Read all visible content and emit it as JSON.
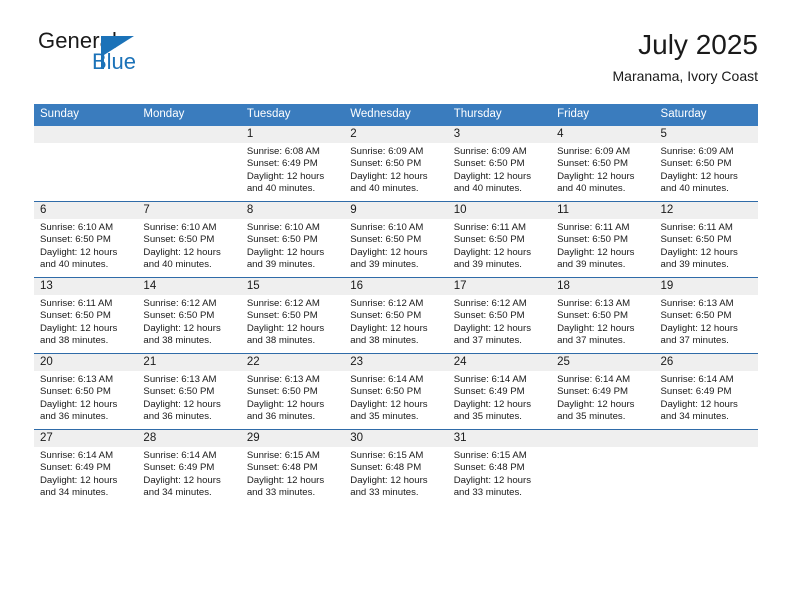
{
  "logo": {
    "word1": "General",
    "word2": "Blue",
    "icon": "triangle-flag-icon",
    "brand_color": "#1b72b8"
  },
  "header": {
    "title": "July 2025",
    "subtitle": "Maranama, Ivory Coast"
  },
  "theme": {
    "header_bg": "#3a7cbe",
    "row_divider": "#2f6ba8",
    "daynum_band": "#efefef"
  },
  "weekday_headers": [
    "Sunday",
    "Monday",
    "Tuesday",
    "Wednesday",
    "Thursday",
    "Friday",
    "Saturday"
  ],
  "weeks": [
    [
      {
        "day": "",
        "lines": []
      },
      {
        "day": "",
        "lines": []
      },
      {
        "day": "1",
        "lines": [
          "Sunrise: 6:08 AM",
          "Sunset: 6:49 PM",
          "Daylight: 12 hours",
          "and 40 minutes."
        ]
      },
      {
        "day": "2",
        "lines": [
          "Sunrise: 6:09 AM",
          "Sunset: 6:50 PM",
          "Daylight: 12 hours",
          "and 40 minutes."
        ]
      },
      {
        "day": "3",
        "lines": [
          "Sunrise: 6:09 AM",
          "Sunset: 6:50 PM",
          "Daylight: 12 hours",
          "and 40 minutes."
        ]
      },
      {
        "day": "4",
        "lines": [
          "Sunrise: 6:09 AM",
          "Sunset: 6:50 PM",
          "Daylight: 12 hours",
          "and 40 minutes."
        ]
      },
      {
        "day": "5",
        "lines": [
          "Sunrise: 6:09 AM",
          "Sunset: 6:50 PM",
          "Daylight: 12 hours",
          "and 40 minutes."
        ]
      }
    ],
    [
      {
        "day": "6",
        "lines": [
          "Sunrise: 6:10 AM",
          "Sunset: 6:50 PM",
          "Daylight: 12 hours",
          "and 40 minutes."
        ]
      },
      {
        "day": "7",
        "lines": [
          "Sunrise: 6:10 AM",
          "Sunset: 6:50 PM",
          "Daylight: 12 hours",
          "and 40 minutes."
        ]
      },
      {
        "day": "8",
        "lines": [
          "Sunrise: 6:10 AM",
          "Sunset: 6:50 PM",
          "Daylight: 12 hours",
          "and 39 minutes."
        ]
      },
      {
        "day": "9",
        "lines": [
          "Sunrise: 6:10 AM",
          "Sunset: 6:50 PM",
          "Daylight: 12 hours",
          "and 39 minutes."
        ]
      },
      {
        "day": "10",
        "lines": [
          "Sunrise: 6:11 AM",
          "Sunset: 6:50 PM",
          "Daylight: 12 hours",
          "and 39 minutes."
        ]
      },
      {
        "day": "11",
        "lines": [
          "Sunrise: 6:11 AM",
          "Sunset: 6:50 PM",
          "Daylight: 12 hours",
          "and 39 minutes."
        ]
      },
      {
        "day": "12",
        "lines": [
          "Sunrise: 6:11 AM",
          "Sunset: 6:50 PM",
          "Daylight: 12 hours",
          "and 39 minutes."
        ]
      }
    ],
    [
      {
        "day": "13",
        "lines": [
          "Sunrise: 6:11 AM",
          "Sunset: 6:50 PM",
          "Daylight: 12 hours",
          "and 38 minutes."
        ]
      },
      {
        "day": "14",
        "lines": [
          "Sunrise: 6:12 AM",
          "Sunset: 6:50 PM",
          "Daylight: 12 hours",
          "and 38 minutes."
        ]
      },
      {
        "day": "15",
        "lines": [
          "Sunrise: 6:12 AM",
          "Sunset: 6:50 PM",
          "Daylight: 12 hours",
          "and 38 minutes."
        ]
      },
      {
        "day": "16",
        "lines": [
          "Sunrise: 6:12 AM",
          "Sunset: 6:50 PM",
          "Daylight: 12 hours",
          "and 38 minutes."
        ]
      },
      {
        "day": "17",
        "lines": [
          "Sunrise: 6:12 AM",
          "Sunset: 6:50 PM",
          "Daylight: 12 hours",
          "and 37 minutes."
        ]
      },
      {
        "day": "18",
        "lines": [
          "Sunrise: 6:13 AM",
          "Sunset: 6:50 PM",
          "Daylight: 12 hours",
          "and 37 minutes."
        ]
      },
      {
        "day": "19",
        "lines": [
          "Sunrise: 6:13 AM",
          "Sunset: 6:50 PM",
          "Daylight: 12 hours",
          "and 37 minutes."
        ]
      }
    ],
    [
      {
        "day": "20",
        "lines": [
          "Sunrise: 6:13 AM",
          "Sunset: 6:50 PM",
          "Daylight: 12 hours",
          "and 36 minutes."
        ]
      },
      {
        "day": "21",
        "lines": [
          "Sunrise: 6:13 AM",
          "Sunset: 6:50 PM",
          "Daylight: 12 hours",
          "and 36 minutes."
        ]
      },
      {
        "day": "22",
        "lines": [
          "Sunrise: 6:13 AM",
          "Sunset: 6:50 PM",
          "Daylight: 12 hours",
          "and 36 minutes."
        ]
      },
      {
        "day": "23",
        "lines": [
          "Sunrise: 6:14 AM",
          "Sunset: 6:50 PM",
          "Daylight: 12 hours",
          "and 35 minutes."
        ]
      },
      {
        "day": "24",
        "lines": [
          "Sunrise: 6:14 AM",
          "Sunset: 6:49 PM",
          "Daylight: 12 hours",
          "and 35 minutes."
        ]
      },
      {
        "day": "25",
        "lines": [
          "Sunrise: 6:14 AM",
          "Sunset: 6:49 PM",
          "Daylight: 12 hours",
          "and 35 minutes."
        ]
      },
      {
        "day": "26",
        "lines": [
          "Sunrise: 6:14 AM",
          "Sunset: 6:49 PM",
          "Daylight: 12 hours",
          "and 34 minutes."
        ]
      }
    ],
    [
      {
        "day": "27",
        "lines": [
          "Sunrise: 6:14 AM",
          "Sunset: 6:49 PM",
          "Daylight: 12 hours",
          "and 34 minutes."
        ]
      },
      {
        "day": "28",
        "lines": [
          "Sunrise: 6:14 AM",
          "Sunset: 6:49 PM",
          "Daylight: 12 hours",
          "and 34 minutes."
        ]
      },
      {
        "day": "29",
        "lines": [
          "Sunrise: 6:15 AM",
          "Sunset: 6:48 PM",
          "Daylight: 12 hours",
          "and 33 minutes."
        ]
      },
      {
        "day": "30",
        "lines": [
          "Sunrise: 6:15 AM",
          "Sunset: 6:48 PM",
          "Daylight: 12 hours",
          "and 33 minutes."
        ]
      },
      {
        "day": "31",
        "lines": [
          "Sunrise: 6:15 AM",
          "Sunset: 6:48 PM",
          "Daylight: 12 hours",
          "and 33 minutes."
        ]
      },
      {
        "day": "",
        "lines": []
      },
      {
        "day": "",
        "lines": []
      }
    ]
  ]
}
